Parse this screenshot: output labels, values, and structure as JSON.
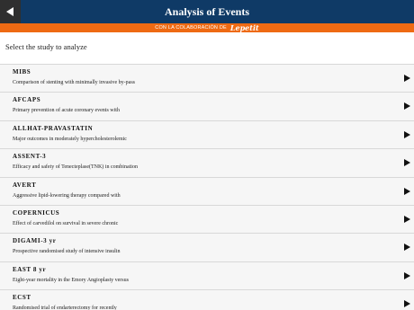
{
  "header": {
    "title": "Analysis of Events",
    "back_icon": "back-arrow-icon"
  },
  "sponsor": {
    "text": "CON LA COLABORACIÓN DE",
    "logo_text": "Lepetit"
  },
  "prompt": "Select the study to analyze",
  "studies": [
    {
      "name": "MIBS",
      "desc": "Comparison of stenting with minimally invasive by-pass"
    },
    {
      "name": "AFCAPS",
      "desc": "Primary prevention of acute coronary events with"
    },
    {
      "name": "ALLHAT-PRAVASTATIN",
      "desc": "Major outcomes in moderately hypercholesterolemic"
    },
    {
      "name": "ASSENT-3",
      "desc": "Efficacy and safety of Tenecteplase(TNK) in combination"
    },
    {
      "name": "AVERT",
      "desc": "Aggressive lipid-lowering therapy compared with"
    },
    {
      "name": "COPERNICUS",
      "desc": "Effect of carvedilol on survival in severe chronic"
    },
    {
      "name": "DIGAMI-3 yr",
      "desc": "Prospective randomised study of intensive insulin"
    },
    {
      "name": "EAST 8 yr",
      "desc": "Eight-year mortality in the Emory Angioplasty versus"
    },
    {
      "name": "ECST",
      "desc": "Randomised trial of endarterectomy for recently"
    }
  ],
  "colors": {
    "header_bg": "#0f3a66",
    "sponsor_bg": "#ee6a13",
    "row_bg": "#f6f6f6"
  }
}
